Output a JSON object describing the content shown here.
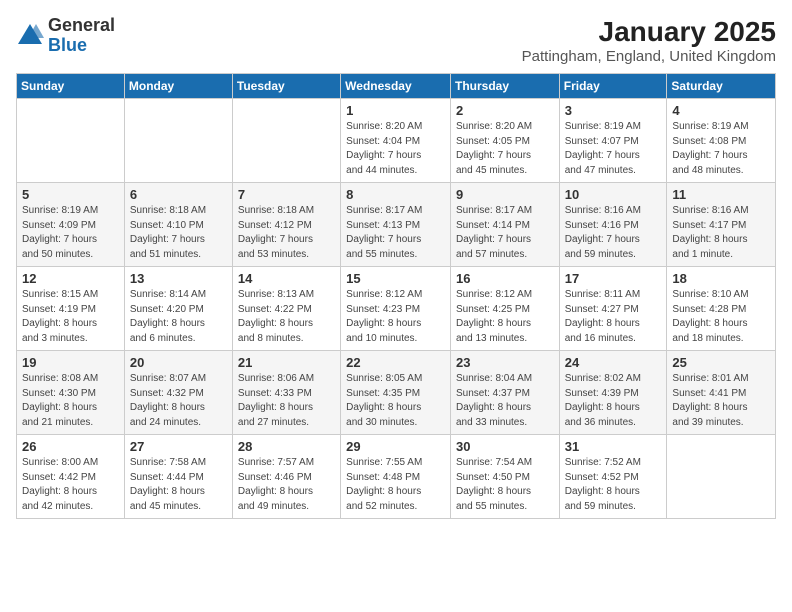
{
  "logo": {
    "general": "General",
    "blue": "Blue"
  },
  "title": "January 2025",
  "subtitle": "Pattingham, England, United Kingdom",
  "weekdays": [
    "Sunday",
    "Monday",
    "Tuesday",
    "Wednesday",
    "Thursday",
    "Friday",
    "Saturday"
  ],
  "weeks": [
    [
      {
        "day": "",
        "info": ""
      },
      {
        "day": "",
        "info": ""
      },
      {
        "day": "",
        "info": ""
      },
      {
        "day": "1",
        "info": "Sunrise: 8:20 AM\nSunset: 4:04 PM\nDaylight: 7 hours\nand 44 minutes."
      },
      {
        "day": "2",
        "info": "Sunrise: 8:20 AM\nSunset: 4:05 PM\nDaylight: 7 hours\nand 45 minutes."
      },
      {
        "day": "3",
        "info": "Sunrise: 8:19 AM\nSunset: 4:07 PM\nDaylight: 7 hours\nand 47 minutes."
      },
      {
        "day": "4",
        "info": "Sunrise: 8:19 AM\nSunset: 4:08 PM\nDaylight: 7 hours\nand 48 minutes."
      }
    ],
    [
      {
        "day": "5",
        "info": "Sunrise: 8:19 AM\nSunset: 4:09 PM\nDaylight: 7 hours\nand 50 minutes."
      },
      {
        "day": "6",
        "info": "Sunrise: 8:18 AM\nSunset: 4:10 PM\nDaylight: 7 hours\nand 51 minutes."
      },
      {
        "day": "7",
        "info": "Sunrise: 8:18 AM\nSunset: 4:12 PM\nDaylight: 7 hours\nand 53 minutes."
      },
      {
        "day": "8",
        "info": "Sunrise: 8:17 AM\nSunset: 4:13 PM\nDaylight: 7 hours\nand 55 minutes."
      },
      {
        "day": "9",
        "info": "Sunrise: 8:17 AM\nSunset: 4:14 PM\nDaylight: 7 hours\nand 57 minutes."
      },
      {
        "day": "10",
        "info": "Sunrise: 8:16 AM\nSunset: 4:16 PM\nDaylight: 7 hours\nand 59 minutes."
      },
      {
        "day": "11",
        "info": "Sunrise: 8:16 AM\nSunset: 4:17 PM\nDaylight: 8 hours\nand 1 minute."
      }
    ],
    [
      {
        "day": "12",
        "info": "Sunrise: 8:15 AM\nSunset: 4:19 PM\nDaylight: 8 hours\nand 3 minutes."
      },
      {
        "day": "13",
        "info": "Sunrise: 8:14 AM\nSunset: 4:20 PM\nDaylight: 8 hours\nand 6 minutes."
      },
      {
        "day": "14",
        "info": "Sunrise: 8:13 AM\nSunset: 4:22 PM\nDaylight: 8 hours\nand 8 minutes."
      },
      {
        "day": "15",
        "info": "Sunrise: 8:12 AM\nSunset: 4:23 PM\nDaylight: 8 hours\nand 10 minutes."
      },
      {
        "day": "16",
        "info": "Sunrise: 8:12 AM\nSunset: 4:25 PM\nDaylight: 8 hours\nand 13 minutes."
      },
      {
        "day": "17",
        "info": "Sunrise: 8:11 AM\nSunset: 4:27 PM\nDaylight: 8 hours\nand 16 minutes."
      },
      {
        "day": "18",
        "info": "Sunrise: 8:10 AM\nSunset: 4:28 PM\nDaylight: 8 hours\nand 18 minutes."
      }
    ],
    [
      {
        "day": "19",
        "info": "Sunrise: 8:08 AM\nSunset: 4:30 PM\nDaylight: 8 hours\nand 21 minutes."
      },
      {
        "day": "20",
        "info": "Sunrise: 8:07 AM\nSunset: 4:32 PM\nDaylight: 8 hours\nand 24 minutes."
      },
      {
        "day": "21",
        "info": "Sunrise: 8:06 AM\nSunset: 4:33 PM\nDaylight: 8 hours\nand 27 minutes."
      },
      {
        "day": "22",
        "info": "Sunrise: 8:05 AM\nSunset: 4:35 PM\nDaylight: 8 hours\nand 30 minutes."
      },
      {
        "day": "23",
        "info": "Sunrise: 8:04 AM\nSunset: 4:37 PM\nDaylight: 8 hours\nand 33 minutes."
      },
      {
        "day": "24",
        "info": "Sunrise: 8:02 AM\nSunset: 4:39 PM\nDaylight: 8 hours\nand 36 minutes."
      },
      {
        "day": "25",
        "info": "Sunrise: 8:01 AM\nSunset: 4:41 PM\nDaylight: 8 hours\nand 39 minutes."
      }
    ],
    [
      {
        "day": "26",
        "info": "Sunrise: 8:00 AM\nSunset: 4:42 PM\nDaylight: 8 hours\nand 42 minutes."
      },
      {
        "day": "27",
        "info": "Sunrise: 7:58 AM\nSunset: 4:44 PM\nDaylight: 8 hours\nand 45 minutes."
      },
      {
        "day": "28",
        "info": "Sunrise: 7:57 AM\nSunset: 4:46 PM\nDaylight: 8 hours\nand 49 minutes."
      },
      {
        "day": "29",
        "info": "Sunrise: 7:55 AM\nSunset: 4:48 PM\nDaylight: 8 hours\nand 52 minutes."
      },
      {
        "day": "30",
        "info": "Sunrise: 7:54 AM\nSunset: 4:50 PM\nDaylight: 8 hours\nand 55 minutes."
      },
      {
        "day": "31",
        "info": "Sunrise: 7:52 AM\nSunset: 4:52 PM\nDaylight: 8 hours\nand 59 minutes."
      },
      {
        "day": "",
        "info": ""
      }
    ]
  ]
}
